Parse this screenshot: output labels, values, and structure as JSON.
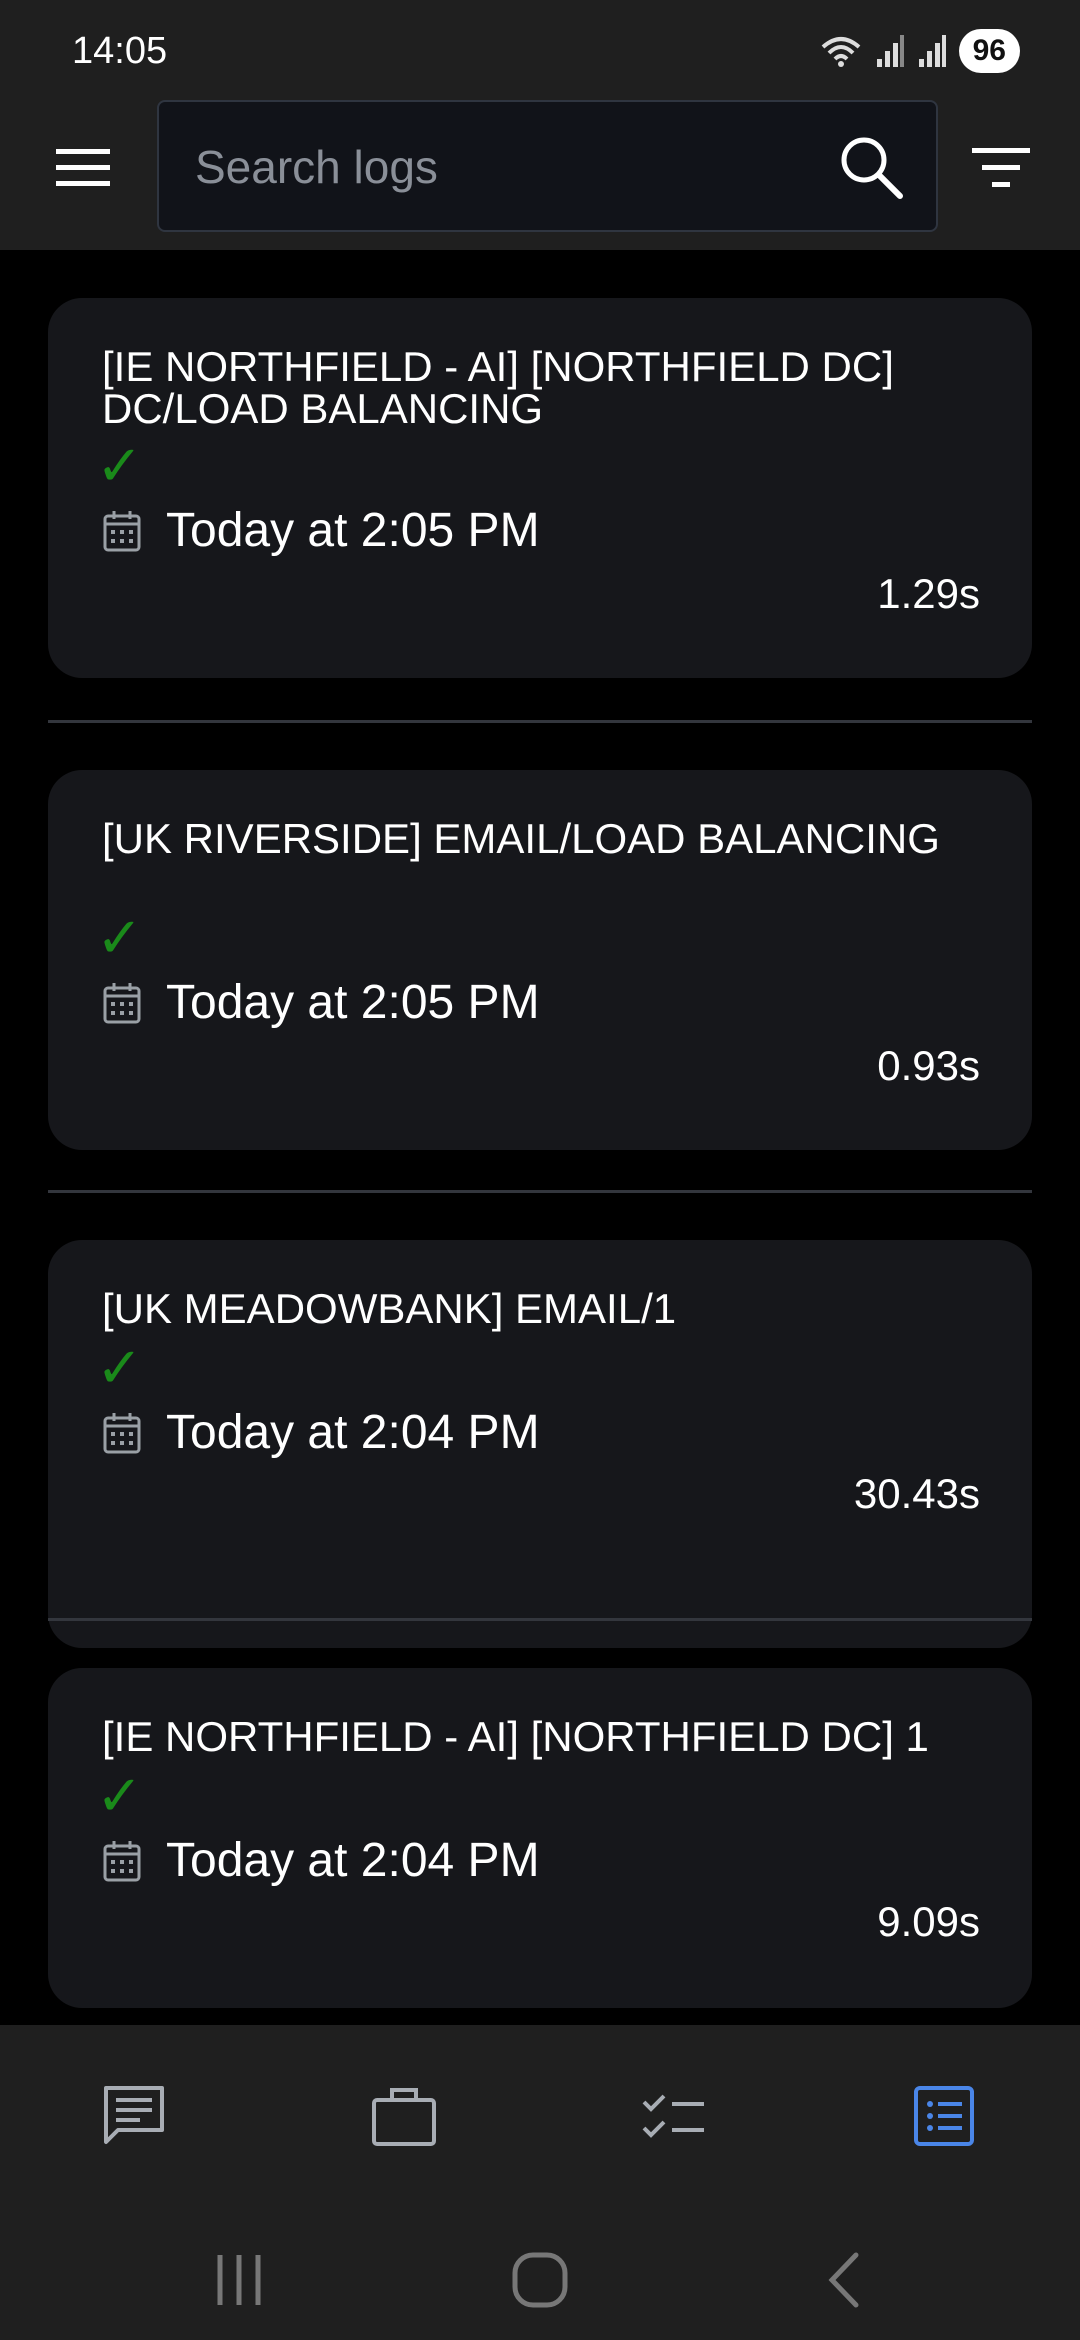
{
  "status_bar": {
    "time": "14:05",
    "battery": "96",
    "icons": [
      "wifi-icon",
      "signal-icon",
      "signal-r-icon"
    ]
  },
  "toolbar": {
    "menu_icon": "menu-icon",
    "search_placeholder": "Search logs",
    "search_value": "",
    "search_icon": "search-icon",
    "filter_icon": "filter-icon"
  },
  "logs": [
    {
      "title": "[IE NORTHFIELD - AI] [NORTHFIELD DC] DC/LOAD BALANCING",
      "status": "✓",
      "date": "Today at 2:05 PM",
      "duration": "1.29s"
    },
    {
      "title": "[UK RIVERSIDE] EMAIL/LOAD BALANCING",
      "status": "✓",
      "date": "Today at 2:05 PM",
      "duration": "0.93s"
    },
    {
      "title": "[UK MEADOWBANK] EMAIL/1",
      "status": "✓",
      "date": "Today at 2:04 PM",
      "duration": "30.43s"
    },
    {
      "title": "[IE NORTHFIELD - AI] [NORTHFIELD DC] 1",
      "status": "✓",
      "date": "Today at 2:04 PM",
      "duration": "9.09s"
    }
  ],
  "bottom_nav": {
    "items": [
      "chat-icon",
      "briefcase-icon",
      "checklist-icon",
      "logs-list-icon"
    ],
    "active": "logs-list-icon",
    "accent_color": "#4a86e8"
  },
  "colors": {
    "success": "#1a8a1a",
    "card_bg": "#16171b",
    "bar_bg": "#1f1f1f"
  }
}
